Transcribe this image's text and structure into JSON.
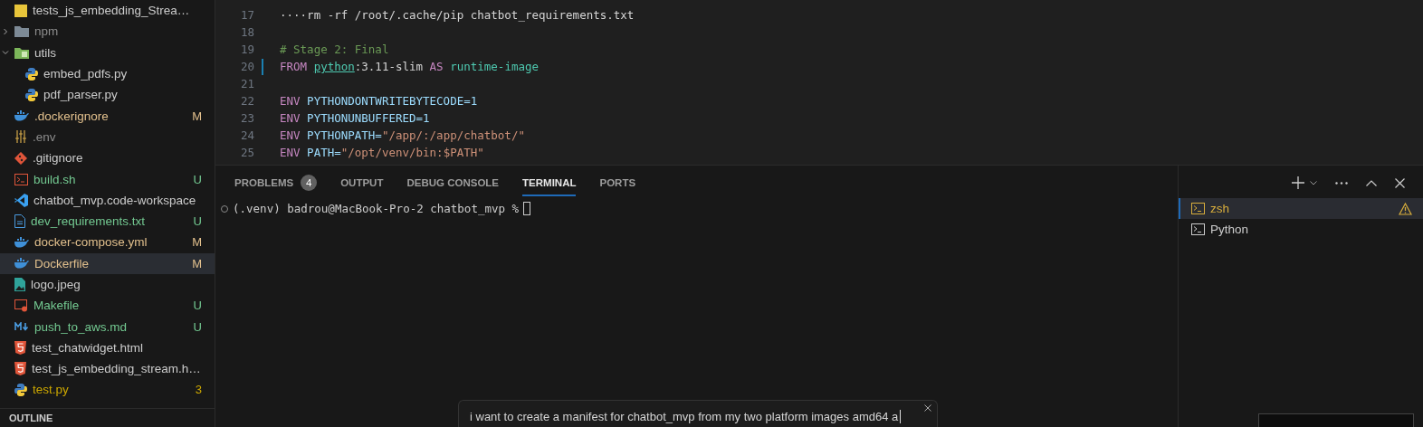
{
  "explorer": {
    "items": [
      {
        "name": "tests_js_embedding_Strea…",
        "kind": "js",
        "color": "#cccccc",
        "selected": false
      },
      {
        "name": "npm",
        "kind": "folder",
        "color": "#8c8c8c",
        "expanded": false,
        "selected": false
      },
      {
        "name": "utils",
        "kind": "folder",
        "color": "#cccccc",
        "expanded": true,
        "selected": false,
        "children": [
          {
            "name": "embed_pdfs.py",
            "kind": "python",
            "color": "#cccccc",
            "selected": false
          },
          {
            "name": "pdf_parser.py",
            "kind": "python",
            "color": "#cccccc",
            "selected": false
          }
        ]
      },
      {
        "name": ".dockerignore",
        "kind": "docker",
        "color": "#e2c08d",
        "badge": "M",
        "selected": false
      },
      {
        "name": ".env",
        "kind": "settings",
        "color": "#8c8c8c",
        "selected": false
      },
      {
        "name": ".gitignore",
        "kind": "git",
        "color": "#cccccc",
        "selected": false
      },
      {
        "name": "build.sh",
        "kind": "shell",
        "color": "#73c991",
        "badge": "U",
        "selected": false
      },
      {
        "name": "chatbot_mvp.code-workspace",
        "kind": "vscode",
        "color": "#cccccc",
        "selected": false
      },
      {
        "name": "dev_requirements.txt",
        "kind": "text",
        "color": "#73c991",
        "badge": "U",
        "selected": false
      },
      {
        "name": "docker-compose.yml",
        "kind": "docker",
        "color": "#e2c08d",
        "badge": "M",
        "selected": false
      },
      {
        "name": "Dockerfile",
        "kind": "docker",
        "color": "#e2c08d",
        "badge": "M",
        "selected": true
      },
      {
        "name": "logo.jpeg",
        "kind": "image",
        "color": "#cccccc",
        "selected": false
      },
      {
        "name": "Makefile",
        "kind": "makefile",
        "color": "#73c991",
        "badge": "U",
        "selected": false
      },
      {
        "name": "push_to_aws.md",
        "kind": "markdown",
        "color": "#73c991",
        "badge": "U",
        "selected": false
      },
      {
        "name": "test_chatwidget.html",
        "kind": "html",
        "color": "#cccccc",
        "selected": false
      },
      {
        "name": "test_js_embedding_stream.h…",
        "kind": "html",
        "color": "#cccccc",
        "selected": false
      },
      {
        "name": "test.py",
        "kind": "python",
        "color": "#cca700",
        "badge": "3",
        "selected": false
      }
    ],
    "outline_header": "OUTLINE"
  },
  "editor": {
    "lines": [
      {
        "number": "17",
        "tokens": [
          {
            "kind": "text",
            "text": "····rm -rf /root/.cache/pip chatbot_requirements.txt"
          }
        ]
      },
      {
        "number": "18"
      },
      {
        "number": "19",
        "tokens": [
          {
            "kind": "comment",
            "text": "# Stage 2: Final"
          }
        ]
      },
      {
        "number": "20",
        "modified": true,
        "tokens": [
          {
            "kind": "keyword",
            "text": "FROM "
          },
          {
            "kind": "link",
            "text": "python"
          },
          {
            "kind": "text",
            "text": ":3.11-slim "
          },
          {
            "kind": "keyword",
            "text": "AS "
          },
          {
            "kind": "image",
            "text": "runtime-image"
          }
        ]
      },
      {
        "number": "21"
      },
      {
        "number": "22",
        "tokens": [
          {
            "kind": "keyword",
            "text": "ENV "
          },
          {
            "kind": "variable",
            "text": "PYTHONDONTWRITEBYTECODE=1"
          }
        ]
      },
      {
        "number": "23",
        "tokens": [
          {
            "kind": "keyword",
            "text": "ENV "
          },
          {
            "kind": "variable",
            "text": "PYTHONUNBUFFERED=1"
          }
        ]
      },
      {
        "number": "24",
        "tokens": [
          {
            "kind": "keyword",
            "text": "ENV "
          },
          {
            "kind": "variable",
            "text": "PYTHONPATH="
          },
          {
            "kind": "string",
            "text": "\"/app/:/app/chatbot/\""
          }
        ]
      },
      {
        "number": "25",
        "tokens": [
          {
            "kind": "keyword",
            "text": "ENV "
          },
          {
            "kind": "variable",
            "text": "PATH="
          },
          {
            "kind": "string",
            "text": "\"/opt/venv/bin:$PATH\""
          }
        ]
      }
    ]
  },
  "panel": {
    "tabs": [
      {
        "label": "PROBLEMS",
        "badge": "4",
        "selected": false
      },
      {
        "label": "OUTPUT",
        "selected": false
      },
      {
        "label": "DEBUG CONSOLE",
        "selected": false
      },
      {
        "label": "TERMINAL",
        "selected": true
      },
      {
        "label": "PORTS",
        "selected": false
      }
    ],
    "terminal": {
      "prompt": "(.venv) badrou@MacBook-Pro-2 chatbot_mvp %"
    },
    "terminals": [
      {
        "name": "zsh",
        "selected": true,
        "warning": true
      },
      {
        "name": "Python",
        "selected": false,
        "warning": false
      }
    ]
  },
  "chat_input": {
    "value": "i want to create a manifest for chatbot_mvp from my two platform images amd64 a"
  }
}
